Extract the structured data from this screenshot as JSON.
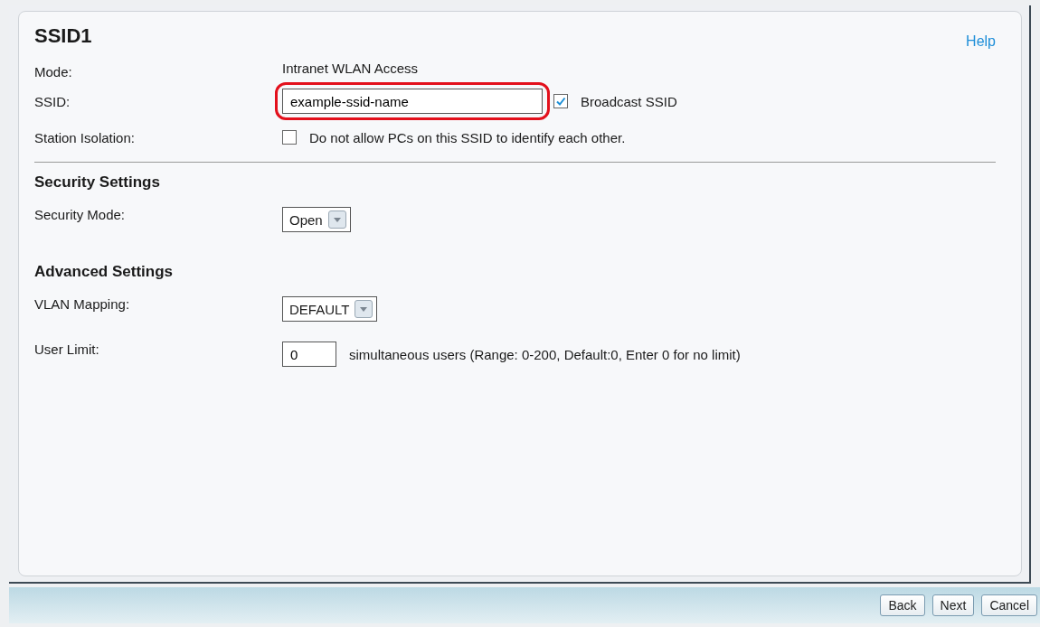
{
  "title": "SSID1",
  "help": "Help",
  "rows": [
    {
      "kind": "text",
      "label": "Mode:",
      "value": "Intranet WLAN Access"
    },
    {
      "kind": "input",
      "label": "SSID:",
      "value": "example-ssid-name",
      "highlighted": true,
      "check": {
        "label": "Broadcast SSID",
        "checked": true
      }
    },
    {
      "kind": "checkbox",
      "label": "Station Isolation:",
      "check": {
        "label": "Do not allow PCs on this SSID to identify each other.",
        "checked": false
      }
    }
  ],
  "sections": [
    {
      "heading": "Security Settings",
      "rows": [
        {
          "kind": "select",
          "label": "Security Mode:",
          "value": "Open"
        }
      ]
    },
    {
      "heading": "Advanced Settings",
      "rows": [
        {
          "kind": "select",
          "label": "VLAN Mapping:",
          "value": "DEFAULT"
        },
        {
          "kind": "number",
          "label": "User Limit:",
          "value": "0",
          "note": "simultaneous users (Range: 0-200, Default:0, Enter 0 for no limit)"
        }
      ]
    }
  ],
  "buttons": [
    "Back",
    "Next",
    "Cancel"
  ]
}
